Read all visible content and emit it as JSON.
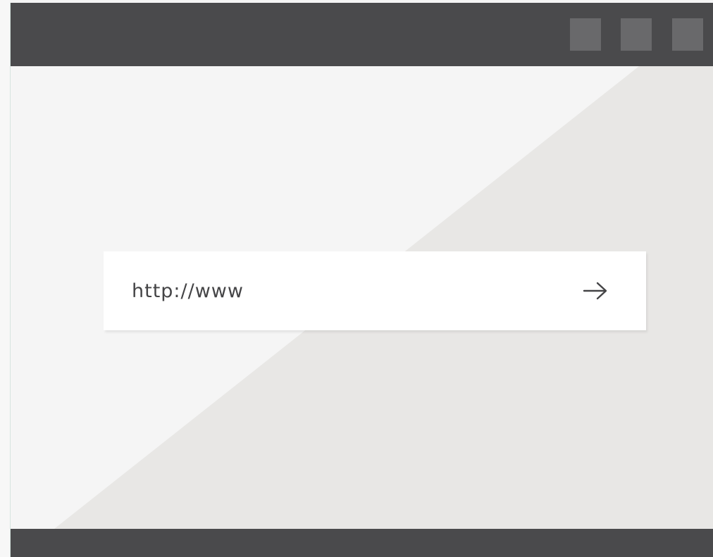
{
  "window": {
    "titlebar_color": "#4a4a4c",
    "controls": [
      "window-control-button",
      "window-control-button",
      "window-control-button"
    ]
  },
  "address_bar": {
    "url_value": "http://www",
    "go_icon": "arrow-right-icon"
  },
  "colors": {
    "background_light": "#f5f5f5",
    "background_diagonal": "#e8e7e5",
    "bars": "#4a4a4c",
    "control_buttons": "#69696b",
    "text": "#444446"
  }
}
